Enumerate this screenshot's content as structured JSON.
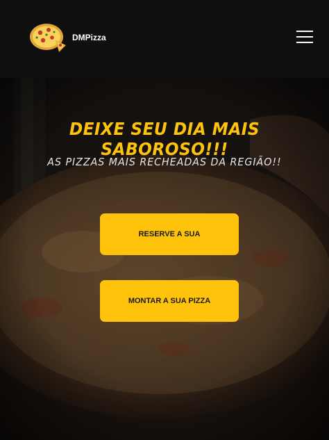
{
  "nav": {
    "brand_name": "DMPizza",
    "logo_icon": "pizza-logo-icon",
    "menu_icon": "hamburger-menu-icon"
  },
  "hero": {
    "headline": "Deixe seu dia mais saboroso!!!",
    "subline": "As pizzas mais recheadas da região!!",
    "background_image": "pizza-photo"
  },
  "buttons": {
    "reserve_label": "Reserve a sua",
    "build_label": "Montar a sua pizza"
  },
  "colors": {
    "accent": "#ffc30b",
    "navbar": "#0f0f0f",
    "headline": "#ffc30b",
    "subline": "#e6e6e6"
  }
}
